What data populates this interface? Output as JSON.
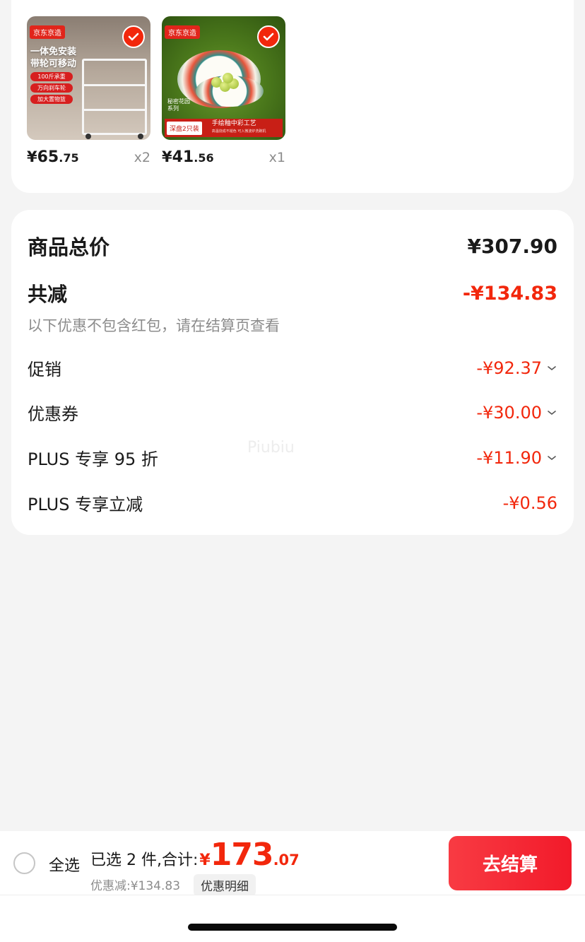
{
  "products": [
    {
      "store_tag": "京东京造",
      "promo_title_1": "一体免安装",
      "promo_title_2": "带轮可移动",
      "promo_points": [
        "100斤承重",
        "万向刹车轮",
        "加大置物篮"
      ],
      "price_yen": "¥",
      "price_int": "65",
      "price_dec": ".75",
      "qty": "x2"
    },
    {
      "store_tag": "京东京造",
      "series_label_1": "秘密花园",
      "series_label_2": "系列",
      "band_tag": "深盘2只装",
      "band_title": "手绘釉中彩工艺",
      "band_subtitle": "高温烧成不褪色 可入微波炉洗碗机",
      "price_yen": "¥",
      "price_int": "41",
      "price_dec": ".56",
      "qty": "x1"
    }
  ],
  "summary": {
    "total_label": "商品总价",
    "total_value": "¥307.90",
    "discount_label": "共减",
    "discount_value": "-¥134.83",
    "hint": "以下优惠不包含红包，请在结算页查看",
    "items": [
      {
        "label": "促销",
        "value": "-¥92.37",
        "expandable": true
      },
      {
        "label": "优惠券",
        "value": "-¥30.00",
        "expandable": true
      },
      {
        "label": "PLUS 专享 95 折",
        "value": "-¥11.90",
        "expandable": true
      },
      {
        "label": "PLUS 专享立减",
        "value": "-¥0.56",
        "expandable": false
      }
    ],
    "watermark": "Piubiu"
  },
  "bottom_bar": {
    "select_all_label": "全选",
    "selected_text": "已选 2 件,合计:",
    "grand_yen": "¥",
    "grand_int": "173",
    "grand_dec": ".07",
    "saved_text": "优惠减:¥134.83",
    "detail_label": "优惠明细",
    "checkout_label": "去结算"
  },
  "colors": {
    "accent_red": "#f2270c",
    "checkout_gradient_start": "#f83b43",
    "checkout_gradient_end": "#f21a2a",
    "page_bg": "#f4f4f4",
    "muted_text": "#8c8c8c"
  }
}
